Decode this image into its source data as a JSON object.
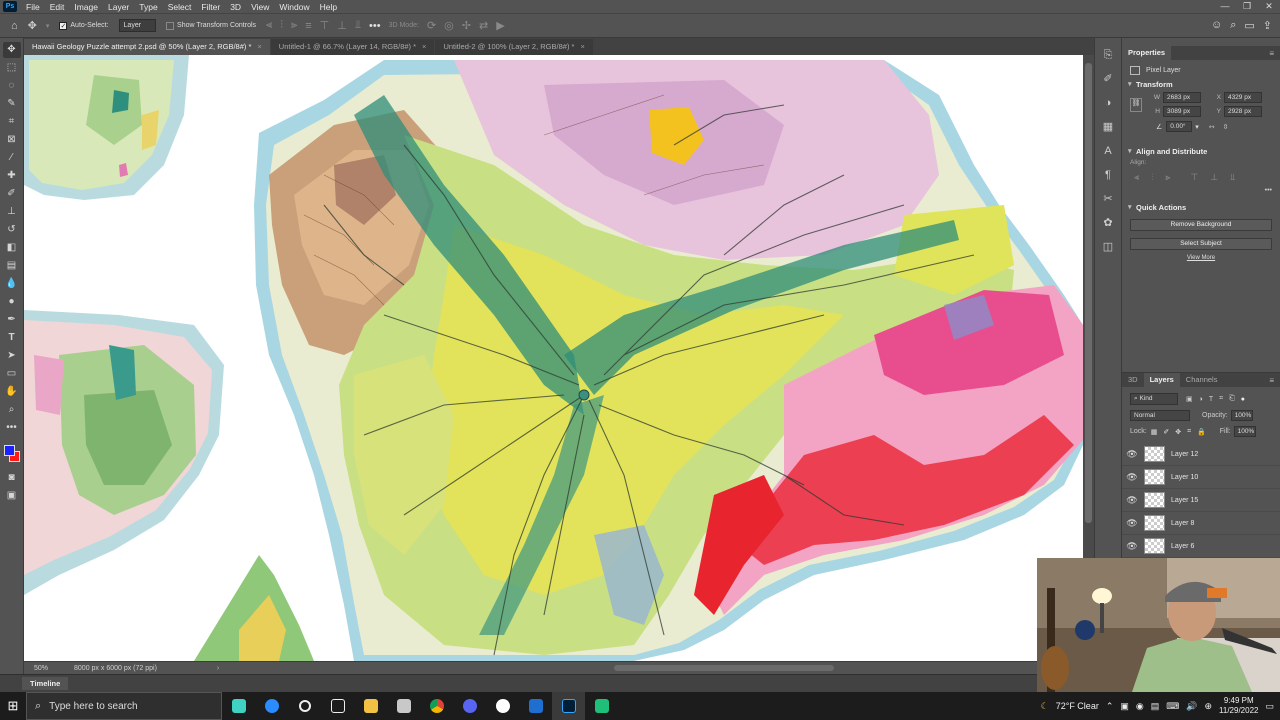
{
  "menubar": {
    "items": [
      "File",
      "Edit",
      "Image",
      "Layer",
      "Type",
      "Select",
      "Filter",
      "3D",
      "View",
      "Window",
      "Help"
    ]
  },
  "options": {
    "auto_select_label": "Auto-Select:",
    "auto_select_target": "Layer",
    "show_transform_label": "Show Transform Controls",
    "mode_3d_label": "3D Mode:"
  },
  "tabs": [
    {
      "label": "Hawaii Geology Puzzle attempt 2.psd @ 50% (Layer 2, RGB/8#) *",
      "active": true
    },
    {
      "label": "Untitled-1 @ 66.7% (Layer 14, RGB/8#) *",
      "active": false
    },
    {
      "label": "Untitled-2 @ 100% (Layer 2, RGB/8#) *",
      "active": false
    }
  ],
  "status": {
    "zoom": "50%",
    "doc_info": "8000 px x 6000 px (72 ppi)"
  },
  "timeline": {
    "label": "Timeline"
  },
  "properties": {
    "tab": "Properties",
    "kind": "Pixel Layer",
    "transform_title": "Transform",
    "w": "2683 px",
    "h": "3089 px",
    "x": "4329 px",
    "y": "2928 px",
    "angle": "0.00°",
    "align_title": "Align and Distribute",
    "align_label": "Align:",
    "quick_actions_title": "Quick Actions",
    "remove_bg": "Remove Background",
    "select_subject": "Select Subject",
    "view_more": "View More"
  },
  "layers": {
    "tabs": [
      "3D",
      "Layers",
      "Channels"
    ],
    "active_tab": "Layers",
    "filter_kind": "Kind",
    "blend_mode": "Normal",
    "opacity_label": "Opacity:",
    "opacity": "100%",
    "lock_label": "Lock:",
    "fill_label": "Fill:",
    "fill": "100%",
    "items": [
      {
        "name": "Layer 12"
      },
      {
        "name": "Layer 10"
      },
      {
        "name": "Layer 15"
      },
      {
        "name": "Layer 8"
      },
      {
        "name": "Layer 6"
      }
    ]
  },
  "taskbar": {
    "search_placeholder": "Type here to search",
    "weather": "72°F Clear",
    "time": "9:49 PM",
    "date": "11/29/2022"
  },
  "colors": {
    "foreground": "#1722ff",
    "background": "#ff1a1a"
  }
}
